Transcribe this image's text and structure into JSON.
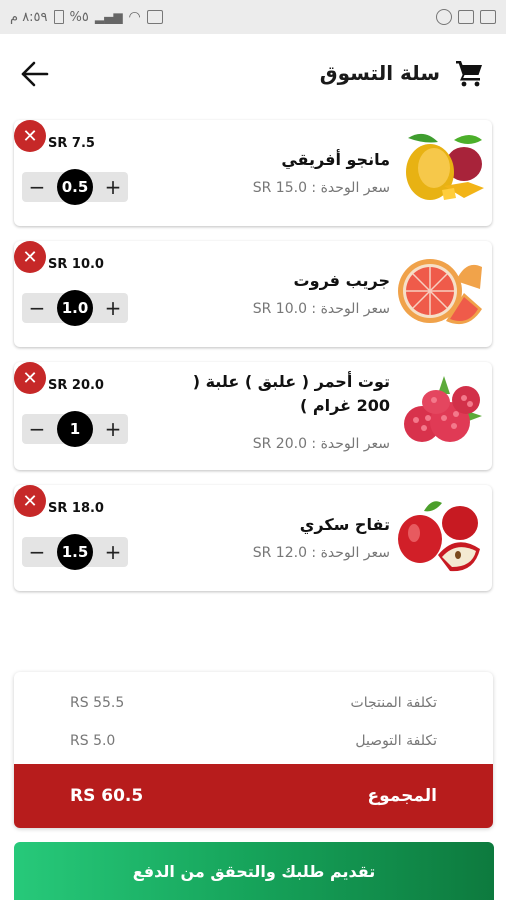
{
  "statusbar": {
    "time": "٨:٥٩ م",
    "battery": "%٥"
  },
  "header": {
    "title": "سلة التسوق"
  },
  "items": [
    {
      "name": "مانجو أفريقي",
      "unit_price": "سعر الوحدة : SR 15.0",
      "price": "SR 7.5",
      "qty": "0.5",
      "image": "mango"
    },
    {
      "name": "جريب فروت",
      "unit_price": "سعر الوحدة : SR 10.0",
      "price": "SR 10.0",
      "qty": "1.0",
      "image": "grapefruit"
    },
    {
      "name": "توت أحمر ( علبق ) علبة ( 200 غرام )",
      "unit_price": "سعر الوحدة : SR 20.0",
      "price": "SR 20.0",
      "qty": "1",
      "image": "raspberry"
    },
    {
      "name": "تفاح سكري",
      "unit_price": "سعر الوحدة : SR 12.0",
      "price": "SR 18.0",
      "qty": "1.5",
      "image": "apple"
    }
  ],
  "stepper": {
    "minus": "−",
    "plus": "+"
  },
  "summary": {
    "products_label": "تكلفة المنتجات",
    "products_value": "RS 55.5",
    "delivery_label": "تكلفة التوصيل",
    "delivery_value": "RS 5.0",
    "total_label": "المجموع",
    "total_value": "RS 60.5"
  },
  "checkout_label": "تقديم طلبك والتحقق من الدفع",
  "colors": {
    "remove": "#c62828",
    "total_bar": "#b71c1c",
    "checkout_start": "#27c97a",
    "checkout_end": "#0d7a3e"
  }
}
